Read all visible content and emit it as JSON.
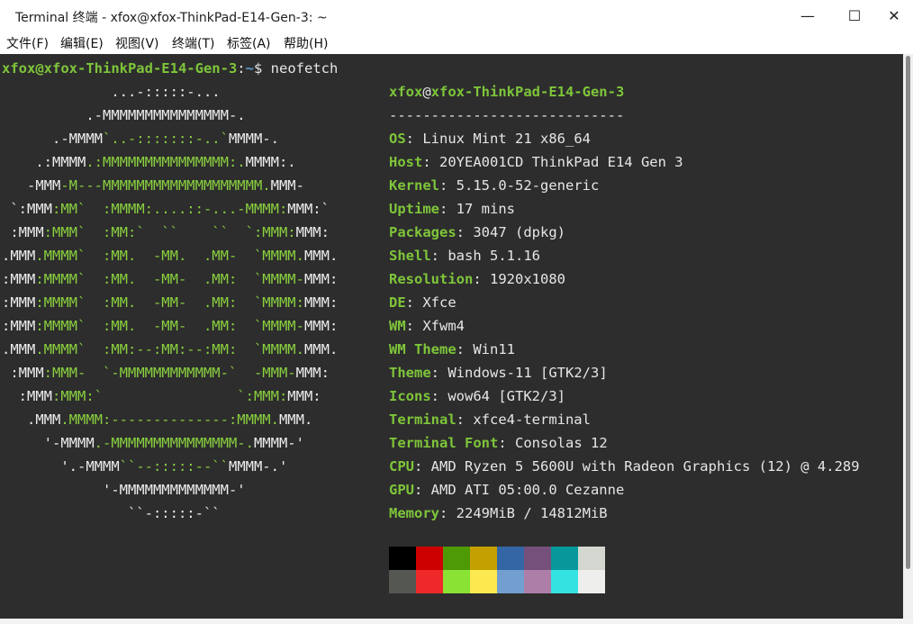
{
  "window": {
    "title": "Terminal 终端 - xfox@xfox-ThinkPad-E14-Gen-3: ~",
    "minimize_glyph": "—",
    "maximize_glyph": "☐",
    "close_glyph": "✕"
  },
  "menu": {
    "items": [
      "文件(F)",
      "编辑(E)",
      "视图(V)",
      "终端(T)",
      "标签(A)",
      "帮助(H)"
    ]
  },
  "prompt": {
    "user_host": "xfox@xfox-ThinkPad-E14-Gen-3",
    "colon": ":",
    "path": "~",
    "symbol": "$",
    "command": "neofetch"
  },
  "info": {
    "user": "xfox",
    "at": "@",
    "host": "xfox-ThinkPad-E14-Gen-3",
    "separator": "----------------------------",
    "fields": [
      {
        "key": "OS",
        "value": "Linux Mint 21 x86_64"
      },
      {
        "key": "Host",
        "value": "20YEA001CD ThinkPad E14 Gen 3"
      },
      {
        "key": "Kernel",
        "value": "5.15.0-52-generic"
      },
      {
        "key": "Uptime",
        "value": "17 mins"
      },
      {
        "key": "Packages",
        "value": "3047 (dpkg)"
      },
      {
        "key": "Shell",
        "value": "bash 5.1.16"
      },
      {
        "key": "Resolution",
        "value": "1920x1080"
      },
      {
        "key": "DE",
        "value": "Xfce"
      },
      {
        "key": "WM",
        "value": "Xfwm4"
      },
      {
        "key": "WM Theme",
        "value": "Win11"
      },
      {
        "key": "Theme",
        "value": "Windows-11 [GTK2/3]"
      },
      {
        "key": "Icons",
        "value": "wow64 [GTK2/3]"
      },
      {
        "key": "Terminal",
        "value": "xfce4-terminal"
      },
      {
        "key": "Terminal Font",
        "value": "Consolas 12"
      },
      {
        "key": "CPU",
        "value": "AMD Ryzen 5 5600U with Radeon Graphics (12) @ 4.289"
      },
      {
        "key": "GPU",
        "value": "AMD ATI 05:00.0 Cezanne"
      },
      {
        "key": "Memory",
        "value": "2249MiB / 14812MiB"
      }
    ]
  },
  "ascii_art": [
    [
      [
        "w",
        "             ...-:::::-..."
      ]
    ],
    [
      [
        "w",
        "          .-MMMMMMMMMMMMMMM-."
      ]
    ],
    [
      [
        "w",
        "      .-MMMM"
      ],
      [
        "g",
        "`..-:::::::-..`"
      ],
      [
        "w",
        "MMMM-."
      ]
    ],
    [
      [
        "w",
        "    .:MMMM"
      ],
      [
        "g",
        ".:MMMMMMMMMMMMMMM:."
      ],
      [
        "w",
        "MMMM:."
      ]
    ],
    [
      [
        "w",
        "   -MMM"
      ],
      [
        "g",
        "-M---MMMMMMMMMMMMMMMMMMM."
      ],
      [
        "w",
        "MMM-"
      ]
    ],
    [
      [
        "w",
        " `:MMM"
      ],
      [
        "g",
        ":MM`  :MMMM:....::-...-MMMM:"
      ],
      [
        "w",
        "MMM:`"
      ]
    ],
    [
      [
        "w",
        " :MMM"
      ],
      [
        "g",
        ":MMM`  :MM:`  ``    ``  `:MMM:"
      ],
      [
        "w",
        "MMM:"
      ]
    ],
    [
      [
        "w",
        ".MMM"
      ],
      [
        "g",
        ".MMMM`  :MM.  -MM.  .MM-  `MMMM."
      ],
      [
        "w",
        "MMM."
      ]
    ],
    [
      [
        "w",
        ":MMM"
      ],
      [
        "g",
        ":MMMM`  :MM.  -MM-  .MM:  `MMMM-"
      ],
      [
        "w",
        "MMM:"
      ]
    ],
    [
      [
        "w",
        ":MMM"
      ],
      [
        "g",
        ":MMMM`  :MM.  -MM-  .MM:  `MMMM:"
      ],
      [
        "w",
        "MMM:"
      ]
    ],
    [
      [
        "w",
        ":MMM"
      ],
      [
        "g",
        ":MMMM`  :MM.  -MM-  .MM:  `MMMM-"
      ],
      [
        "w",
        "MMM:"
      ]
    ],
    [
      [
        "w",
        ".MMM"
      ],
      [
        "g",
        ".MMMM`  :MM:--:MM:--:MM:  `MMMM."
      ],
      [
        "w",
        "MMM."
      ]
    ],
    [
      [
        "w",
        " :MMM"
      ],
      [
        "g",
        ":MMM-  `-MMMMMMMMMMMM-`  -MMM-"
      ],
      [
        "w",
        "MMM:"
      ]
    ],
    [
      [
        "w",
        "  :MMM"
      ],
      [
        "g",
        ":MMM:`                `:MMM:"
      ],
      [
        "w",
        "MMM:"
      ]
    ],
    [
      [
        "w",
        "   .MMM"
      ],
      [
        "g",
        ".MMMM:--------------:MMMM."
      ],
      [
        "w",
        "MMM."
      ]
    ],
    [
      [
        "w",
        "     '-MMMM"
      ],
      [
        "g",
        ".-MMMMMMMMMMMMMMM-."
      ],
      [
        "w",
        "MMMM-'"
      ]
    ],
    [
      [
        "w",
        "       '.-MMMM"
      ],
      [
        "g",
        "``--:::::--``"
      ],
      [
        "w",
        "MMMM-.'"
      ]
    ],
    [
      [
        "w",
        "            '-MMMMMMMMMMMMM-'"
      ]
    ],
    [
      [
        "w",
        "               ``-:::::-``"
      ]
    ]
  ],
  "palette": {
    "normal": [
      "#000000",
      "#cc0000",
      "#4e9a06",
      "#c4a000",
      "#3465a4",
      "#75507b",
      "#06989a",
      "#d3d7cf"
    ],
    "bright": [
      "#555753",
      "#ef2929",
      "#8ae234",
      "#fce94f",
      "#729fcf",
      "#ad7fa8",
      "#34e2e2",
      "#eeeeec"
    ]
  },
  "colors": {
    "terminal_bg": "#2d2d2d",
    "accent_green": "#7ec53a",
    "text": "#e6e6e6"
  }
}
